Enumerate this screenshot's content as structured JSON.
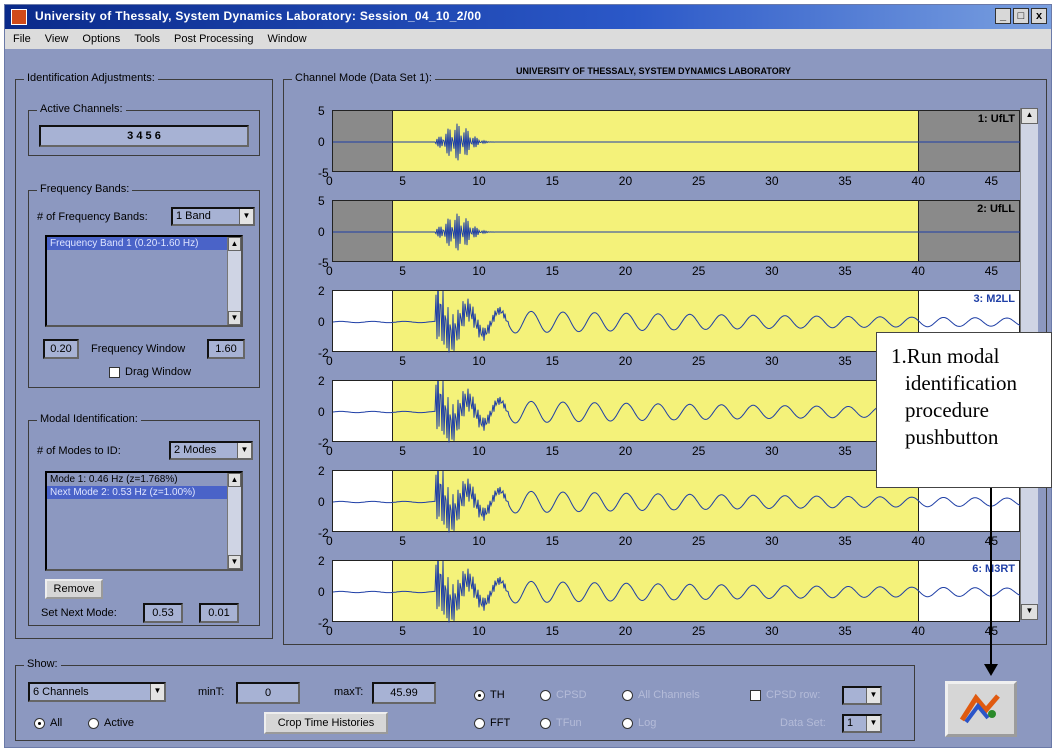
{
  "window": {
    "title": "University of Thessaly, System Dynamics Laboratory: Session_04_10_2/00",
    "controls": [
      "_",
      "□",
      "x"
    ]
  },
  "menu": [
    "File",
    "View",
    "Options",
    "Tools",
    "Post Processing",
    "Window"
  ],
  "identification": {
    "title": "Identification Adjustments:",
    "active_channels": {
      "title": "Active Channels:",
      "value": "3 4 5 6"
    },
    "frequency_bands": {
      "title": "Frequency Bands:",
      "count_label": "# of Frequency Bands:",
      "count_value": "1 Band",
      "list": [
        "Frequency Band 1 (0.20-1.60 Hz)"
      ],
      "min": "0.20",
      "window_label": "Frequency Window",
      "max": "1.60",
      "drag_label": "Drag Window"
    },
    "modal": {
      "title": "Modal Identification:",
      "modes_label": "# of Modes to ID:",
      "modes_value": "2 Modes",
      "list": [
        "Mode 1: 0.46 Hz (z=1.768%)",
        "Next Mode 2: 0.53 Hz (z=1.00%)"
      ],
      "remove_label": "Remove",
      "set_next_label": "Set Next Mode:",
      "next_freq": "0.53",
      "next_damp": "0.01"
    }
  },
  "channel_mode": {
    "title": "Channel Mode (Data Set 1):",
    "header": "UNIVERSITY OF THESSALY, SYSTEM DYNAMICS LABORATORY",
    "x_ticks": [
      "0",
      "5",
      "10",
      "15",
      "20",
      "25",
      "30",
      "35",
      "40",
      "45"
    ]
  },
  "chart_data": {
    "type": "line",
    "xlim": [
      0,
      47
    ],
    "window": [
      4,
      40
    ],
    "channels": [
      {
        "label": "1: UfLT",
        "active": false,
        "y_ticks": [
          "5",
          "0",
          "-5"
        ]
      },
      {
        "label": "2: UfLL",
        "active": false,
        "y_ticks": [
          "5",
          "0",
          "-5"
        ]
      },
      {
        "label": "3: M2LL",
        "active": true,
        "y_ticks": [
          "2",
          "0",
          "-2"
        ]
      },
      {
        "label": "",
        "active": true,
        "y_ticks": [
          "2",
          "0",
          "-2"
        ]
      },
      {
        "label": "",
        "active": true,
        "y_ticks": [
          "2",
          "0",
          "-2"
        ]
      },
      {
        "label": "6: M3RT",
        "active": true,
        "y_ticks": [
          "2",
          "0",
          "-2"
        ]
      }
    ]
  },
  "show": {
    "title": "Show:",
    "channels_value": "6 Channels",
    "min_label": "minT:",
    "min_value": "0",
    "max_label": "maxT:",
    "max_value": "45.99",
    "all_label": "All",
    "active_label": "Active",
    "crop_label": "Crop Time Histories",
    "radios": [
      {
        "label": "TH",
        "on": true
      },
      {
        "label": "FFT",
        "on": false
      },
      {
        "label": "CPSD",
        "on": false
      },
      {
        "label": "TFun",
        "on": false
      },
      {
        "label": "All Channels",
        "on": false
      },
      {
        "label": "Log",
        "on": false
      }
    ],
    "cpsd_label": "CPSD row:",
    "data_set_label": "Data Set:",
    "data_set_value": "1"
  },
  "callout": {
    "lines": [
      "1.Run modal",
      "identification",
      "procedure",
      "pushbutton"
    ]
  }
}
